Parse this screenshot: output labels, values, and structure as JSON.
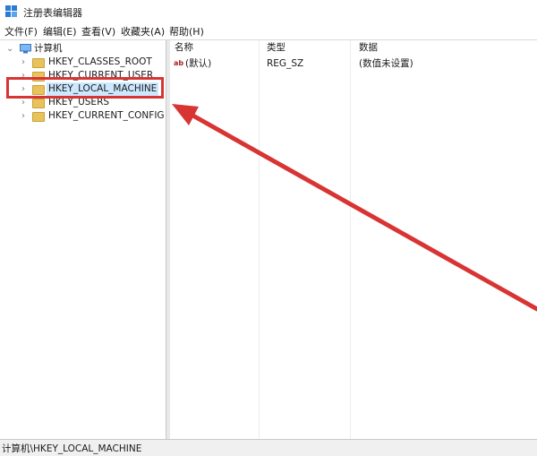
{
  "window": {
    "title": "注册表编辑器"
  },
  "menu": [
    {
      "label": "文件(F)"
    },
    {
      "label": "编辑(E)"
    },
    {
      "label": "查看(V)"
    },
    {
      "label": "收藏夹(A)"
    },
    {
      "label": "帮助(H)"
    }
  ],
  "tree": {
    "root": "计算机",
    "items": [
      {
        "label": "HKEY_CLASSES_ROOT"
      },
      {
        "label": "HKEY_CURRENT_USER"
      },
      {
        "label": "HKEY_LOCAL_MACHINE"
      },
      {
        "label": "HKEY_USERS"
      },
      {
        "label": "HKEY_CURRENT_CONFIG"
      }
    ],
    "selected_item": "HKEY_LOCAL_MACHINE"
  },
  "list": {
    "columns": [
      "名称",
      "类型",
      "数据"
    ],
    "rows": [
      {
        "icon": "ab",
        "name": "(默认)",
        "type": "REG_SZ",
        "data": "(数值未设置)"
      }
    ]
  },
  "status": {
    "path": "计算机\\HKEY_LOCAL_MACHINE"
  },
  "colors": {
    "highlight": "#d93434",
    "selection": "#cce8ff",
    "folder": "#e8c25a"
  }
}
